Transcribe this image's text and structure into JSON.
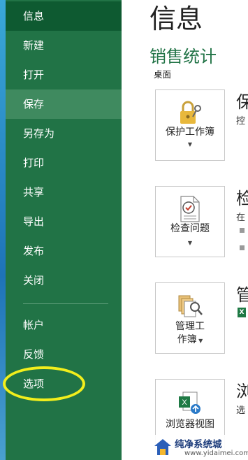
{
  "sidebar": {
    "items": [
      {
        "label": "信息"
      },
      {
        "label": "新建"
      },
      {
        "label": "打开"
      },
      {
        "label": "保存"
      },
      {
        "label": "另存为"
      },
      {
        "label": "打印"
      },
      {
        "label": "共享"
      },
      {
        "label": "导出"
      },
      {
        "label": "发布"
      },
      {
        "label": "关闭"
      },
      {
        "label": "帐户"
      },
      {
        "label": "反馈"
      },
      {
        "label": "选项"
      }
    ]
  },
  "main": {
    "title": "信息",
    "workbook_name": "销售统计",
    "workbook_location": "桌面",
    "sections": [
      {
        "button_line1": "保护工作簿",
        "button_line2": "",
        "heading_partial": "保",
        "desc_partial": "控"
      },
      {
        "button_line1": "检查问题",
        "button_line2": "",
        "heading_partial": "检",
        "desc_partial": "在"
      },
      {
        "button_line1": "管理工",
        "button_line2": "作簿",
        "heading_partial": "管",
        "desc_partial": ""
      },
      {
        "button_line1": "浏览器视图",
        "button_line2": "",
        "heading_partial": "浏",
        "desc_partial": "选"
      }
    ]
  },
  "watermark": {
    "name": "纯净系统城",
    "url": "www.yidaimei.com"
  },
  "colors": {
    "sidebar": "#217346",
    "active": "#0e5a31",
    "highlight": "#f2ee1c",
    "accent": "#217346"
  }
}
